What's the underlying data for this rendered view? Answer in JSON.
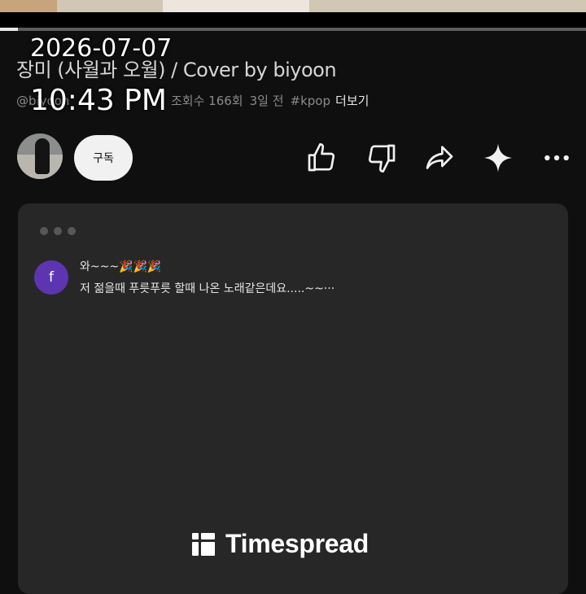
{
  "video": {
    "title": "장미 (사월과 오월) / Cover by biyoon",
    "progress_fraction": 0.03,
    "meta": {
      "channel_handle": "@biyoon",
      "views": "조회수 166회",
      "age": "3일 전",
      "hashtag": "#kpop",
      "more_label": "더보기"
    }
  },
  "channel": {
    "subscribe_label": "구독"
  },
  "actions": {
    "like_icon": "thumbs-up-icon",
    "dislike_icon": "thumbs-down-icon",
    "share_icon": "share-icon",
    "ask_icon": "sparkle-icon",
    "more_icon": "more-horizontal-icon"
  },
  "comment": {
    "avatar_letter": "f",
    "line1": "와~~~🎉🎉🎉",
    "line2": "저 젊을때 푸릇푸릇 할때 나온 노래같은데요.....~~···"
  },
  "overlay": {
    "date": "2026-07-07",
    "time": "10:43 PM"
  },
  "watermark": {
    "text": "Timespread"
  },
  "colors": {
    "background": "#0f0f0f",
    "card": "#272727",
    "commenter_avatar": "#5e35b1",
    "subscribe_bg": "#f1f1f1"
  }
}
